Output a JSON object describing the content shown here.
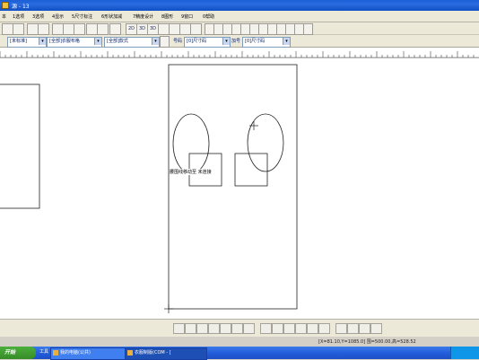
{
  "window": {
    "title": "源 - 13"
  },
  "menu": [
    "本",
    "1选项",
    "3选项",
    "4显示",
    "5尺寸标注",
    "6形状加减",
    "7精度设计",
    "8图形",
    "9窗口",
    "0帮助"
  ],
  "toolbar1": {
    "buttons": [
      "",
      "",
      "",
      "",
      "",
      "",
      "",
      "",
      "",
      "",
      "",
      "",
      "2D",
      "3D",
      "3D",
      "",
      "",
      "",
      "",
      "",
      "",
      "",
      "",
      "",
      "",
      "",
      "",
      "",
      "",
      "",
      "",
      "",
      "",
      ""
    ]
  },
  "toolbar2": {
    "combos": [
      {
        "value": "[未标准]"
      },
      {
        "value": "[全部]衣服布格"
      },
      {
        "value": "[全部]款式"
      }
    ],
    "labels": [
      "号码",
      "加号"
    ],
    "combo_values": [
      "[0]尺寸码",
      "[0]尺寸码"
    ]
  },
  "canvas": {
    "text_label": "腰围线移动至  未连接"
  },
  "status": {
    "text": "[X=81.10,Y=1085.0] 围=500.00,高=528.52"
  },
  "taskbar": {
    "start": "开始",
    "tray_label": "工具",
    "tasks": [
      "我的电脑(公共)",
      "衣服制版(COM - ["
    ]
  },
  "colors": {
    "titlebar": "#0f4fc3",
    "taskbar": "#245edb",
    "start": "#378c28"
  }
}
